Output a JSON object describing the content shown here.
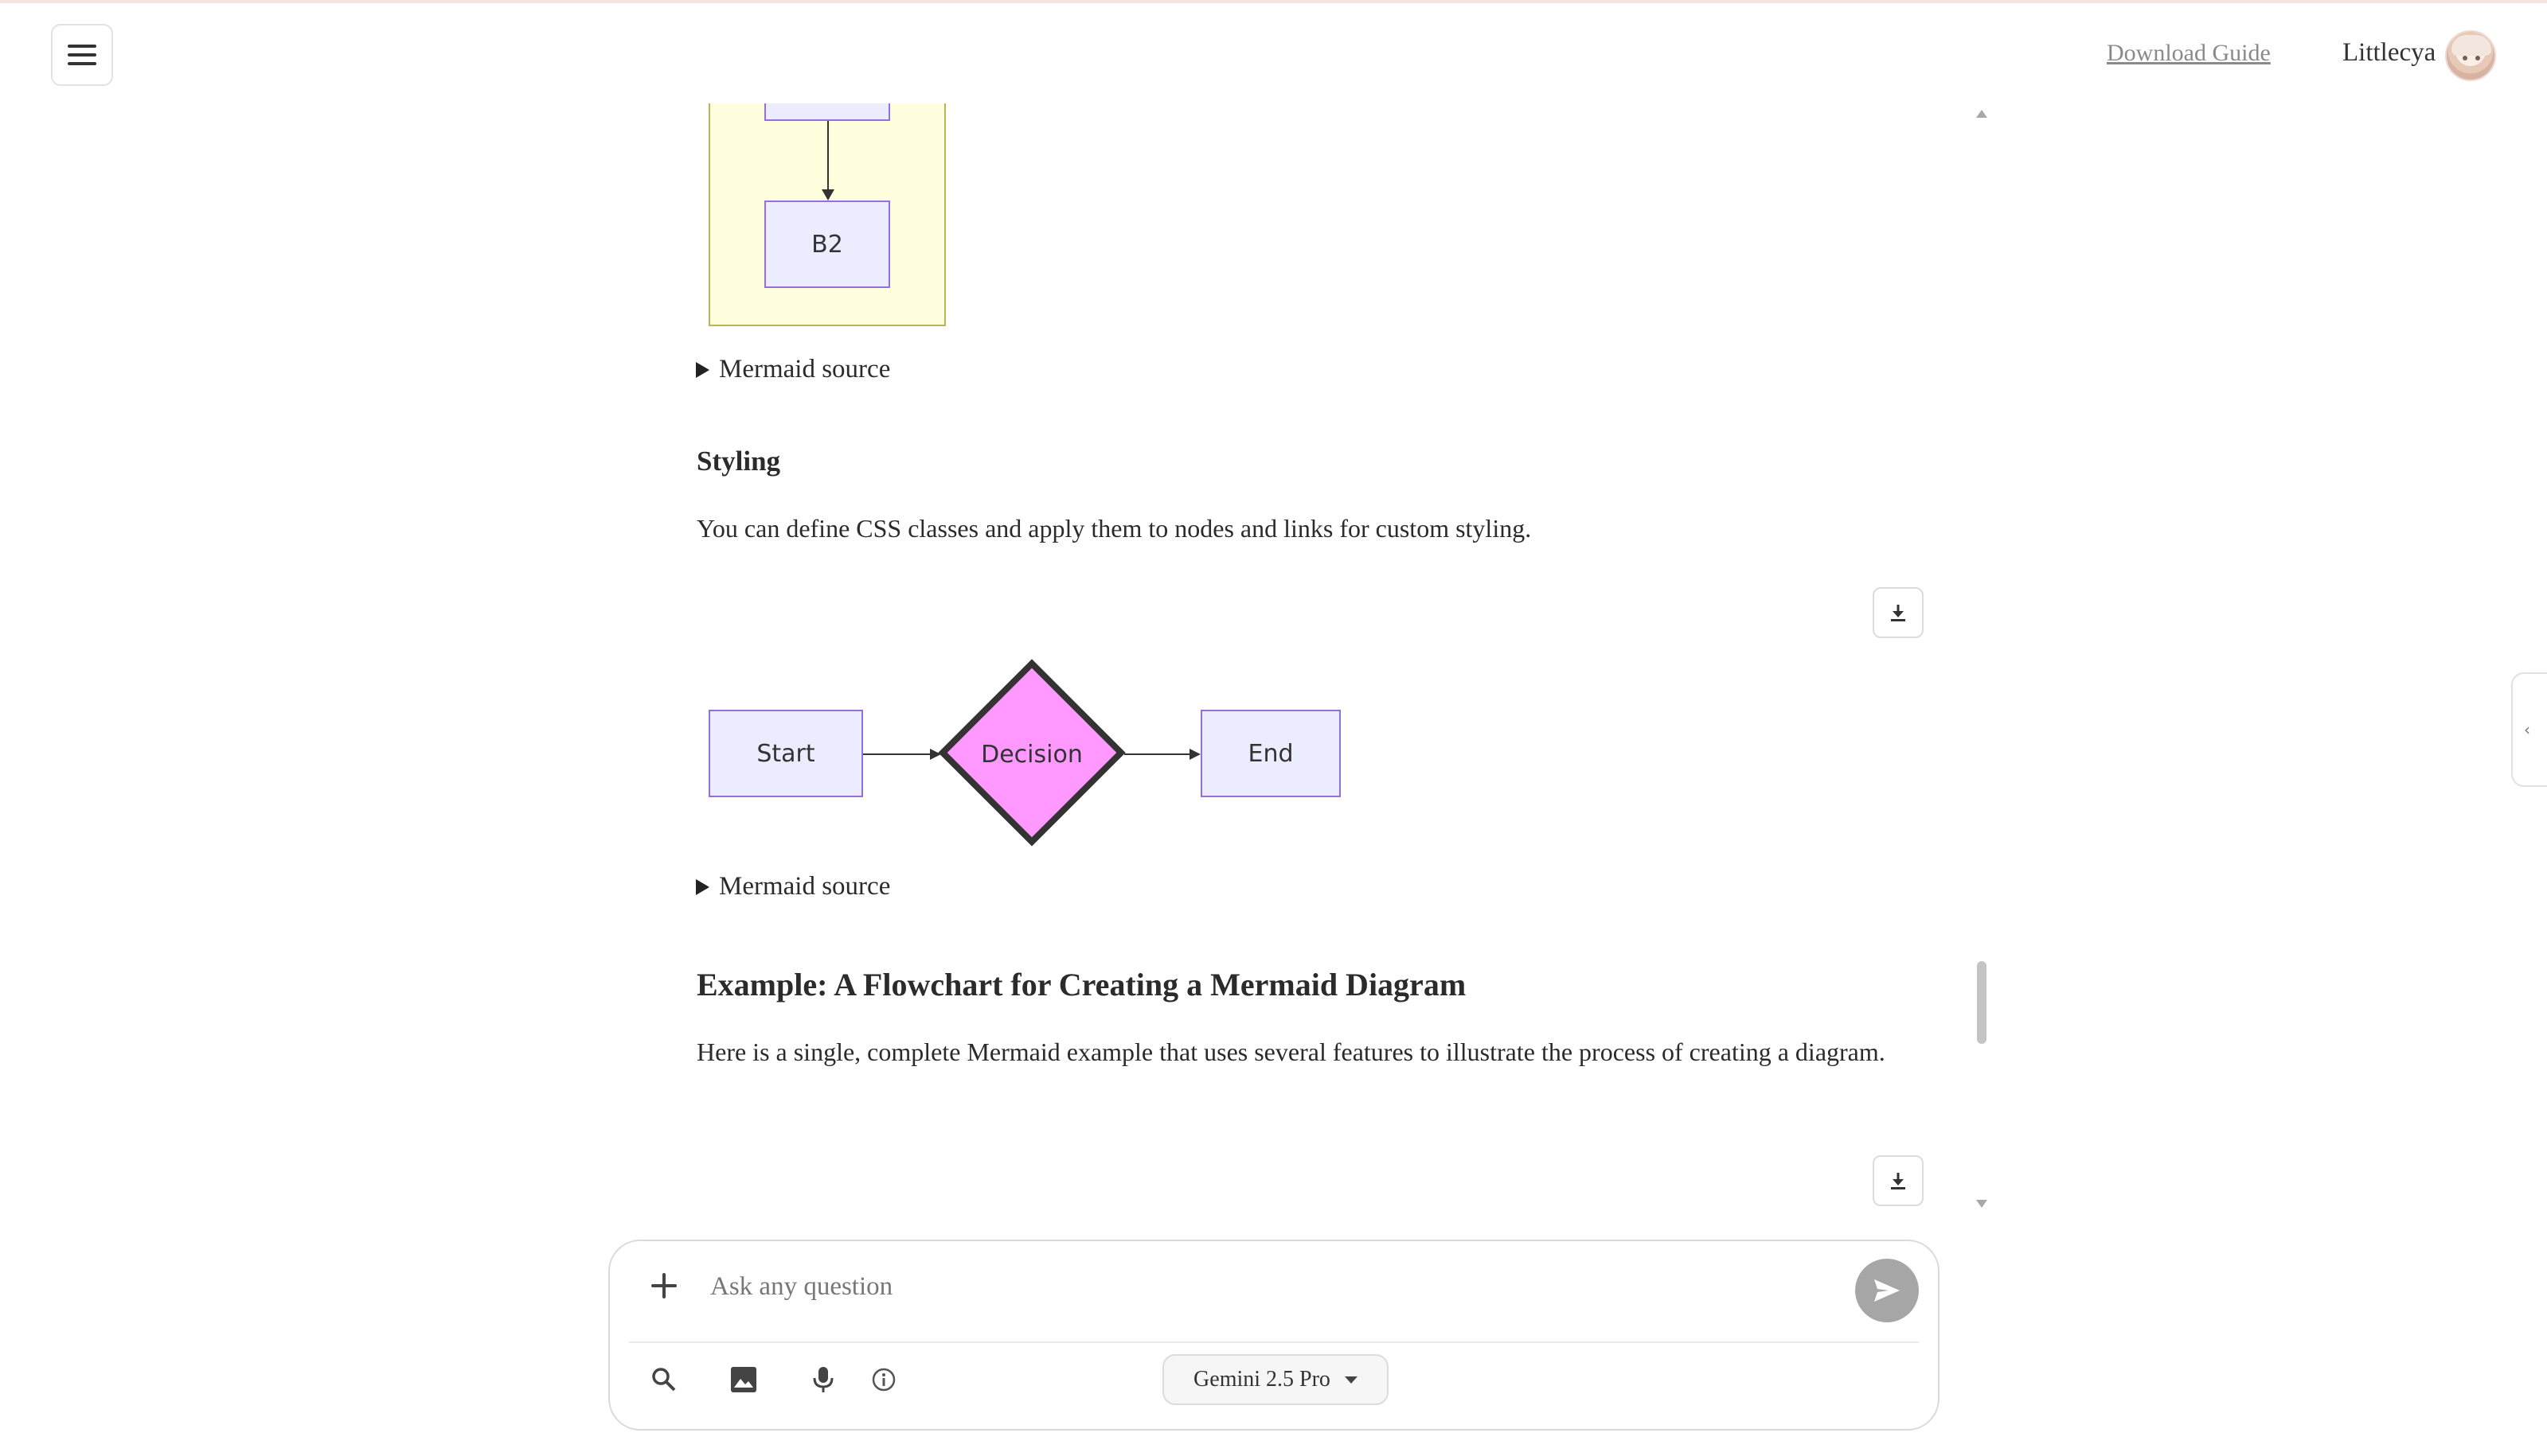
{
  "header": {
    "download_guide": "Download Guide",
    "user_name": "Littlecya"
  },
  "diagram_top": {
    "node_b2": "B2"
  },
  "sections": {
    "mermaid_source_1": "Mermaid source",
    "styling_heading": "Styling",
    "styling_text": "You can define CSS classes and apply them to nodes and links for custom styling.",
    "mermaid_source_2": "Mermaid source",
    "example_heading": "Example: A Flowchart for Creating a Mermaid Diagram",
    "example_text": "Here is a single, complete Mermaid example that uses several features to illustrate the process of creating a diagram."
  },
  "styling_diagram": {
    "nodes": [
      "Start",
      "Decision",
      "End"
    ],
    "decision_fill": "#ff99ff",
    "decision_stroke": "#333333",
    "node_fill": "#ececff",
    "node_stroke": "#9370db"
  },
  "composer": {
    "placeholder": "Ask any question",
    "model": "Gemini 2.5 Pro"
  },
  "side_tab": {
    "glyph": "‹"
  },
  "icons": [
    "menu-icon",
    "download-icon",
    "plus-icon",
    "send-icon",
    "search-icon",
    "image-icon",
    "mic-icon",
    "info-icon",
    "chevron-down-icon",
    "chevron-left-icon"
  ]
}
